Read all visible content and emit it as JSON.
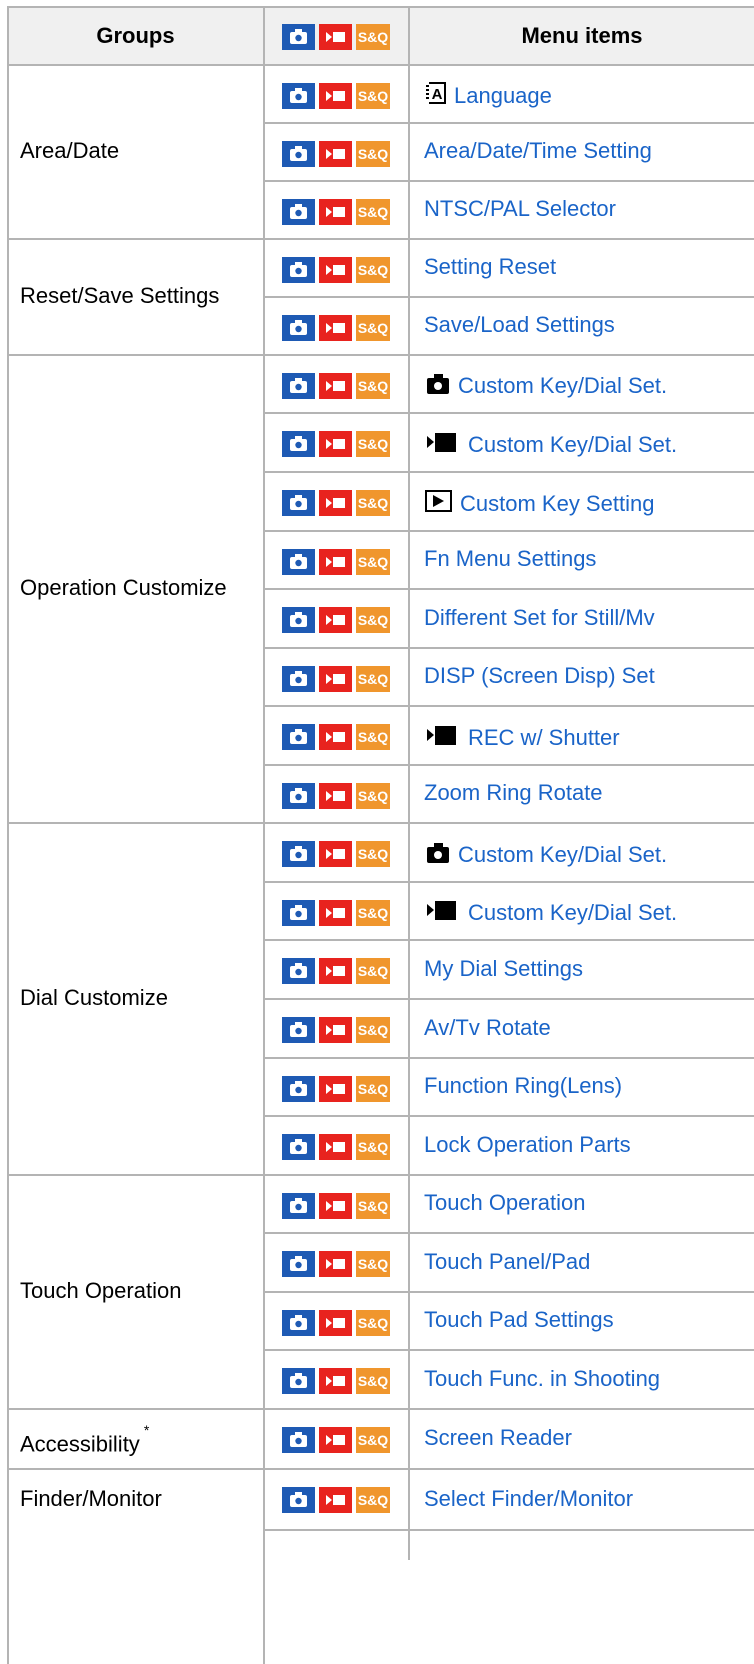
{
  "header": {
    "groups_label": "Groups",
    "menu_items_label": "Menu items",
    "sq_label": "S&Q"
  },
  "sq_label": "S&Q",
  "groups": [
    {
      "name": "Area/Date",
      "asterisk": ""
    },
    {
      "name": "Reset/Save Settings",
      "asterisk": ""
    },
    {
      "name": "Operation Customize",
      "asterisk": ""
    },
    {
      "name": "Dial Customize",
      "asterisk": ""
    },
    {
      "name": "Touch Operation",
      "asterisk": ""
    },
    {
      "name": "Accessibility",
      "asterisk": "*"
    },
    {
      "name": "Finder/Monitor",
      "asterisk": ""
    }
  ],
  "items": [
    {
      "label": "Language",
      "icon": "language-icon"
    },
    {
      "label": "Area/Date/Time Setting",
      "icon": ""
    },
    {
      "label": "NTSC/PAL Selector",
      "icon": ""
    },
    {
      "label": "Setting Reset",
      "icon": ""
    },
    {
      "label": "Save/Load Settings",
      "icon": ""
    },
    {
      "label": "Custom Key/Dial Set.",
      "icon": "still-camera-icon"
    },
    {
      "label": "Custom Key/Dial Set.",
      "icon": "movie-icon"
    },
    {
      "label": "Custom Key Setting",
      "icon": "playback-icon"
    },
    {
      "label": "Fn Menu Settings",
      "icon": ""
    },
    {
      "label": "Different Set for Still/Mv",
      "icon": ""
    },
    {
      "label": "DISP (Screen Disp) Set",
      "icon": ""
    },
    {
      "label": "REC w/ Shutter",
      "icon": "movie-icon"
    },
    {
      "label": "Zoom Ring Rotate",
      "icon": ""
    },
    {
      "label": "Custom Key/Dial Set.",
      "icon": "still-camera-icon"
    },
    {
      "label": "Custom Key/Dial Set.",
      "icon": "movie-icon"
    },
    {
      "label": "My Dial Settings",
      "icon": ""
    },
    {
      "label": "Av/Tv Rotate",
      "icon": ""
    },
    {
      "label": "Function Ring(Lens)",
      "icon": ""
    },
    {
      "label": "Lock Operation Parts",
      "icon": ""
    },
    {
      "label": "Touch Operation",
      "icon": ""
    },
    {
      "label": "Touch Panel/Pad",
      "icon": ""
    },
    {
      "label": "Touch Pad Settings",
      "icon": ""
    },
    {
      "label": "Touch Func. in Shooting",
      "icon": ""
    },
    {
      "label": "Screen Reader",
      "icon": ""
    },
    {
      "label": "Select Finder/Monitor",
      "icon": ""
    }
  ],
  "colors": {
    "still": "#1e5ab4",
    "movie": "#e8231e",
    "sq": "#f0962d",
    "link": "#1a64c8"
  }
}
